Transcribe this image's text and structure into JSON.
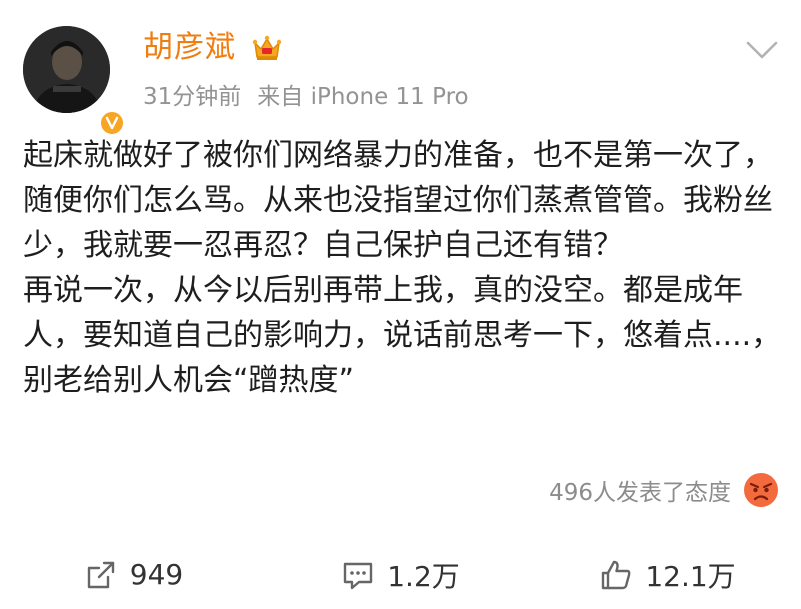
{
  "post": {
    "author": {
      "name": "胡彦斌",
      "verified": true,
      "badge_icon": "crown-icon",
      "name_color": "#f07d10"
    },
    "meta": {
      "time": "31分钟前",
      "source": "来自 iPhone 11 Pro"
    },
    "content": {
      "paragraph1": "起床就做好了被你们网络暴力的准备，也不是第一次了，随便你们怎么骂。从来也没指望过你们蒸煮管管。我粉丝少，我就要一忍再忍？自己保护自己还有错？",
      "paragraph2": "再说一次，从今以后别再带上我，真的没空。都是成年人，要知道自己的影响力，说话前思考一下，悠着点....，别老给别人机会“蹭热度”"
    },
    "reactions": {
      "label": "496人发表了态度",
      "icon": "angry-face-icon"
    },
    "actions": {
      "repost": {
        "icon": "repost-icon",
        "count": "949"
      },
      "comment": {
        "icon": "comment-icon",
        "count": "1.2万"
      },
      "like": {
        "icon": "thumbs-up-icon",
        "count": "12.1万"
      }
    }
  }
}
